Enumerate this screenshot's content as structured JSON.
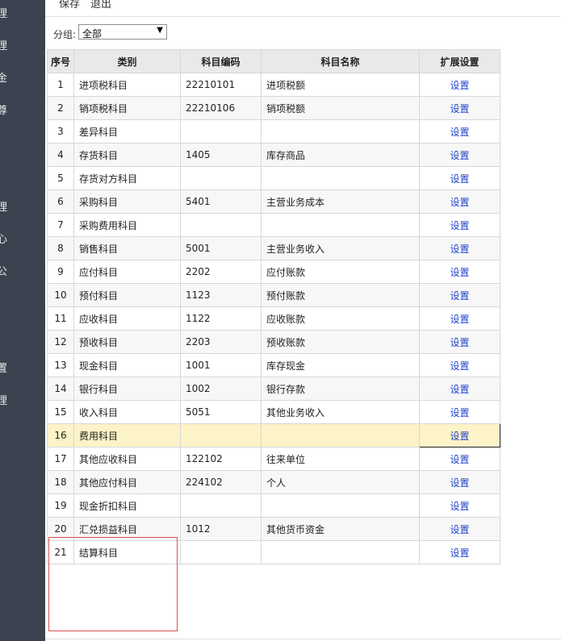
{
  "sidebar": {
    "items": [
      "理",
      "理",
      "金",
      "尊",
      "理",
      "心",
      "公",
      "置",
      "理"
    ]
  },
  "toolbar": {
    "save_label": "保存",
    "exit_label": "退出"
  },
  "filter": {
    "label": "分组:",
    "selected": "全部",
    "arrow": "▼"
  },
  "table": {
    "headers": [
      "序号",
      "类别",
      "科目编码",
      "科目名称",
      "扩展设置"
    ],
    "link_label": "设置",
    "rows": [
      {
        "no": "1",
        "category": "进项税科目",
        "code": "22210101",
        "name": "进项税额"
      },
      {
        "no": "2",
        "category": "销项税科目",
        "code": "22210106",
        "name": "销项税额"
      },
      {
        "no": "3",
        "category": "差异科目",
        "code": "",
        "name": ""
      },
      {
        "no": "4",
        "category": "存货科目",
        "code": "1405",
        "name": "库存商品"
      },
      {
        "no": "5",
        "category": "存货对方科目",
        "code": "",
        "name": ""
      },
      {
        "no": "6",
        "category": "采购科目",
        "code": "5401",
        "name": "主营业务成本"
      },
      {
        "no": "7",
        "category": "采购费用科目",
        "code": "",
        "name": ""
      },
      {
        "no": "8",
        "category": "销售科目",
        "code": "5001",
        "name": "主营业务收入"
      },
      {
        "no": "9",
        "category": "应付科目",
        "code": "2202",
        "name": "应付账款"
      },
      {
        "no": "10",
        "category": "预付科目",
        "code": "1123",
        "name": "预付账款"
      },
      {
        "no": "11",
        "category": "应收科目",
        "code": "1122",
        "name": "应收账款"
      },
      {
        "no": "12",
        "category": "预收科目",
        "code": "2203",
        "name": "预收账款"
      },
      {
        "no": "13",
        "category": "现金科目",
        "code": "1001",
        "name": "库存现金"
      },
      {
        "no": "14",
        "category": "银行科目",
        "code": "1002",
        "name": "银行存款"
      },
      {
        "no": "15",
        "category": "收入科目",
        "code": "5051",
        "name": "其他业务收入"
      },
      {
        "no": "16",
        "category": "费用科目",
        "code": "",
        "name": ""
      },
      {
        "no": "17",
        "category": "其他应收科目",
        "code": "122102",
        "name": "往来单位"
      },
      {
        "no": "18",
        "category": "其他应付科目",
        "code": "224102",
        "name": "个人"
      },
      {
        "no": "19",
        "category": "现金折扣科目",
        "code": "",
        "name": ""
      },
      {
        "no": "20",
        "category": "汇兑损益科目",
        "code": "1012",
        "name": "其他货币资金"
      },
      {
        "no": "21",
        "category": "结算科目",
        "code": "",
        "name": ""
      }
    ],
    "highlighted_row": "16"
  },
  "colors": {
    "sidebar_bg": "#3b4350",
    "header_bg": "#e9e9e9",
    "highlight_bg": "#fdf3c8",
    "link": "#2244cc",
    "annotation": "#d9534f"
  }
}
